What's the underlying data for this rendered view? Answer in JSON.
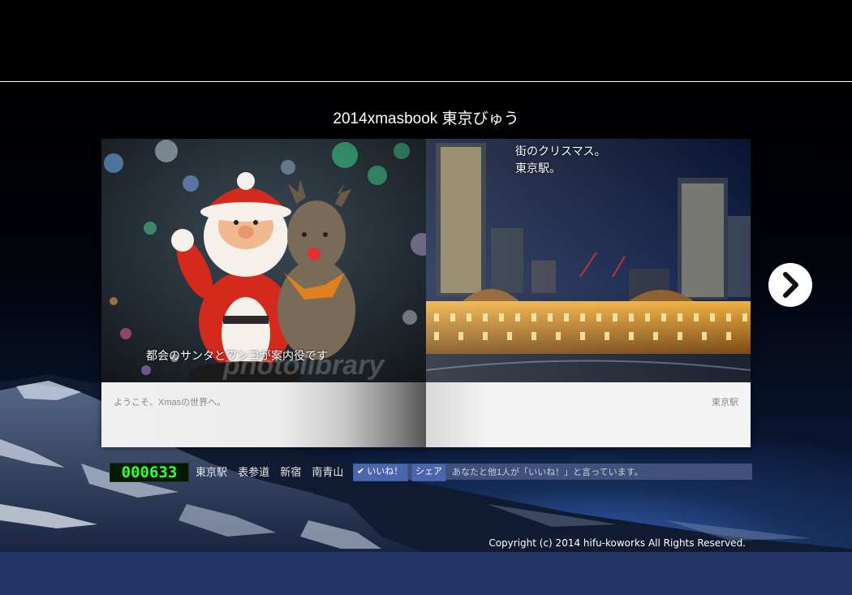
{
  "page": {
    "title": "2014xmasbook 東京びゅう"
  },
  "book": {
    "left_page": {
      "caption": "都会のサンタとワンコが案内役です",
      "text": "ようこそ、Xmasの世界へ。",
      "watermark": "photolibrary"
    },
    "right_page": {
      "caption_line1": "街のクリスマス。",
      "caption_line2": "東京駅。",
      "text": "東京駅"
    },
    "next_icon": "chevron-right-icon"
  },
  "infobar": {
    "counter": "000633",
    "links": [
      "東京駅",
      "表参道",
      "新宿",
      "南青山"
    ],
    "like_label": "いいね！",
    "share_label": "シェア",
    "like_text": "あなたと他1人が「いいね！」と言っています。"
  },
  "footer": {
    "copyright": "Copyright (c) 2014 hifu-koworks All Rights Reserved."
  },
  "colors": {
    "background": "#000000",
    "footer_band": "#223366",
    "counter_digits": "#38ff38",
    "facebook_blue": "#4a67ad"
  }
}
